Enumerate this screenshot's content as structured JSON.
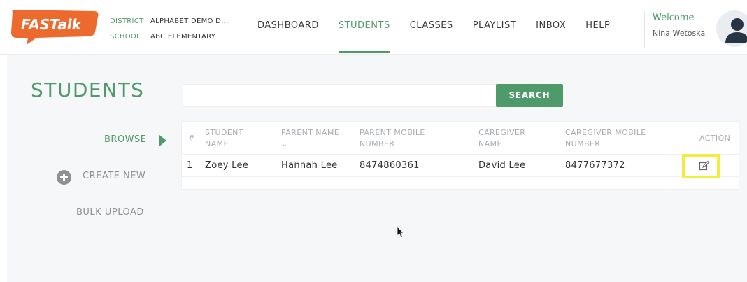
{
  "brand": {
    "logo_text": "FASTalk",
    "color": "#ec6a2e"
  },
  "header": {
    "district_label": "DISTRICT",
    "district_value": "ALPHABET DEMO D...",
    "school_label": "SCHOOL",
    "school_value": "ABC ELEMENTARY",
    "nav": [
      {
        "label": "DASHBOARD",
        "active": false
      },
      {
        "label": "STUDENTS",
        "active": true
      },
      {
        "label": "CLASSES",
        "active": false
      },
      {
        "label": "PLAYLIST",
        "active": false
      },
      {
        "label": "INBOX",
        "active": false
      },
      {
        "label": "HELP",
        "active": false
      }
    ],
    "welcome": "Welcome",
    "user_name": "Nina Wetoska",
    "avatar_icon": "user-icon"
  },
  "page": {
    "title": "STUDENTS",
    "search_placeholder": "",
    "search_button": "SEARCH"
  },
  "sidebar": {
    "browse": "BROWSE",
    "create_new": "CREATE NEW",
    "bulk_upload": "BULK UPLOAD"
  },
  "table": {
    "columns": {
      "index": "#",
      "student_name": "STUDENT NAME",
      "parent_name": "PARENT NAME",
      "parent_mobile": "PARENT MOBILE NUMBER",
      "caregiver_name": "CAREGIVER NAME",
      "caregiver_mobile": "CAREGIVER MOBILE NUMBER",
      "action": "ACTION"
    },
    "sort_indicator": "⌄",
    "rows": [
      {
        "index": "1",
        "student_name": "Zoey Lee",
        "parent_name": "Hannah Lee",
        "parent_mobile": "8474860361",
        "caregiver_name": "David Lee",
        "caregiver_mobile": "8477677372",
        "action_icon": "edit-icon"
      }
    ]
  },
  "colors": {
    "accent": "#4f9a6a",
    "highlight": "#f2ed3c",
    "muted": "#8e9194"
  }
}
